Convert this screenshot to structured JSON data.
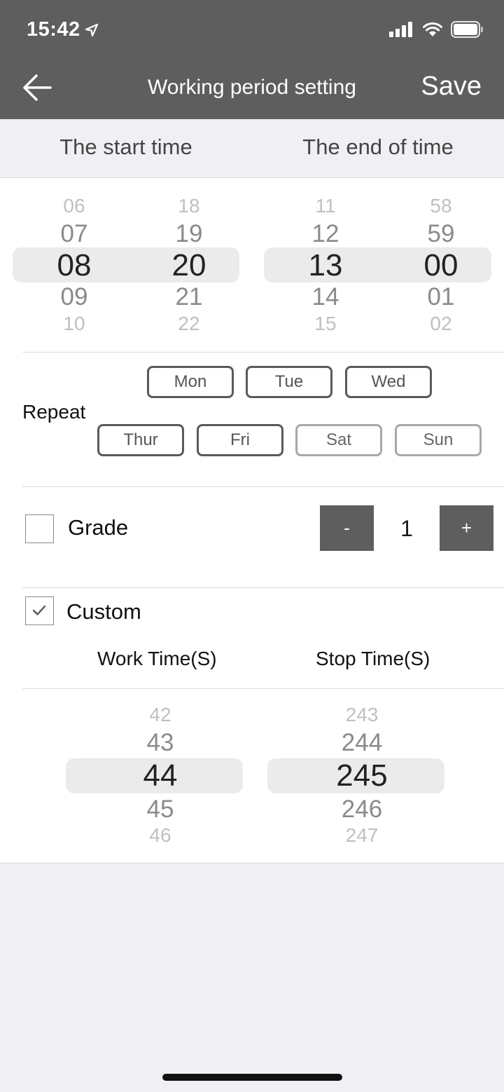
{
  "status_bar": {
    "time": "15:42"
  },
  "nav": {
    "title": "Working period setting",
    "save_label": "Save"
  },
  "header": {
    "start_label": "The start time",
    "end_label": "The end of time"
  },
  "start_time": {
    "hours": [
      "06",
      "07",
      "08",
      "09",
      "10"
    ],
    "minutes": [
      "18",
      "19",
      "20",
      "21",
      "22"
    ],
    "selected": {
      "hour": "08",
      "minute": "20"
    }
  },
  "end_time": {
    "hours": [
      "11",
      "12",
      "13",
      "14",
      "15"
    ],
    "minutes": [
      "58",
      "59",
      "00",
      "01",
      "02"
    ],
    "selected": {
      "hour": "13",
      "minute": "00"
    }
  },
  "repeat": {
    "label": "Repeat",
    "days": [
      {
        "label": "Mon",
        "active": true
      },
      {
        "label": "Tue",
        "active": true
      },
      {
        "label": "Wed",
        "active": true
      },
      {
        "label": "Thur",
        "active": true
      },
      {
        "label": "Fri",
        "active": true
      },
      {
        "label": "Sat",
        "active": false
      },
      {
        "label": "Sun",
        "active": false
      }
    ]
  },
  "grade": {
    "label": "Grade",
    "checked": false,
    "minus": "-",
    "plus": "+",
    "value": "1"
  },
  "custom": {
    "label": "Custom",
    "checked": true,
    "work_label": "Work Time(S)",
    "stop_label": "Stop Time(S)",
    "work_values": [
      "42",
      "43",
      "44",
      "45",
      "46"
    ],
    "stop_values": [
      "243",
      "244",
      "245",
      "246",
      "247"
    ],
    "selected": {
      "work": "44",
      "stop": "245"
    }
  },
  "colors": {
    "bar": "#5e5e5e",
    "background": "#f0f0f4",
    "highlight": "#ebebeb"
  }
}
